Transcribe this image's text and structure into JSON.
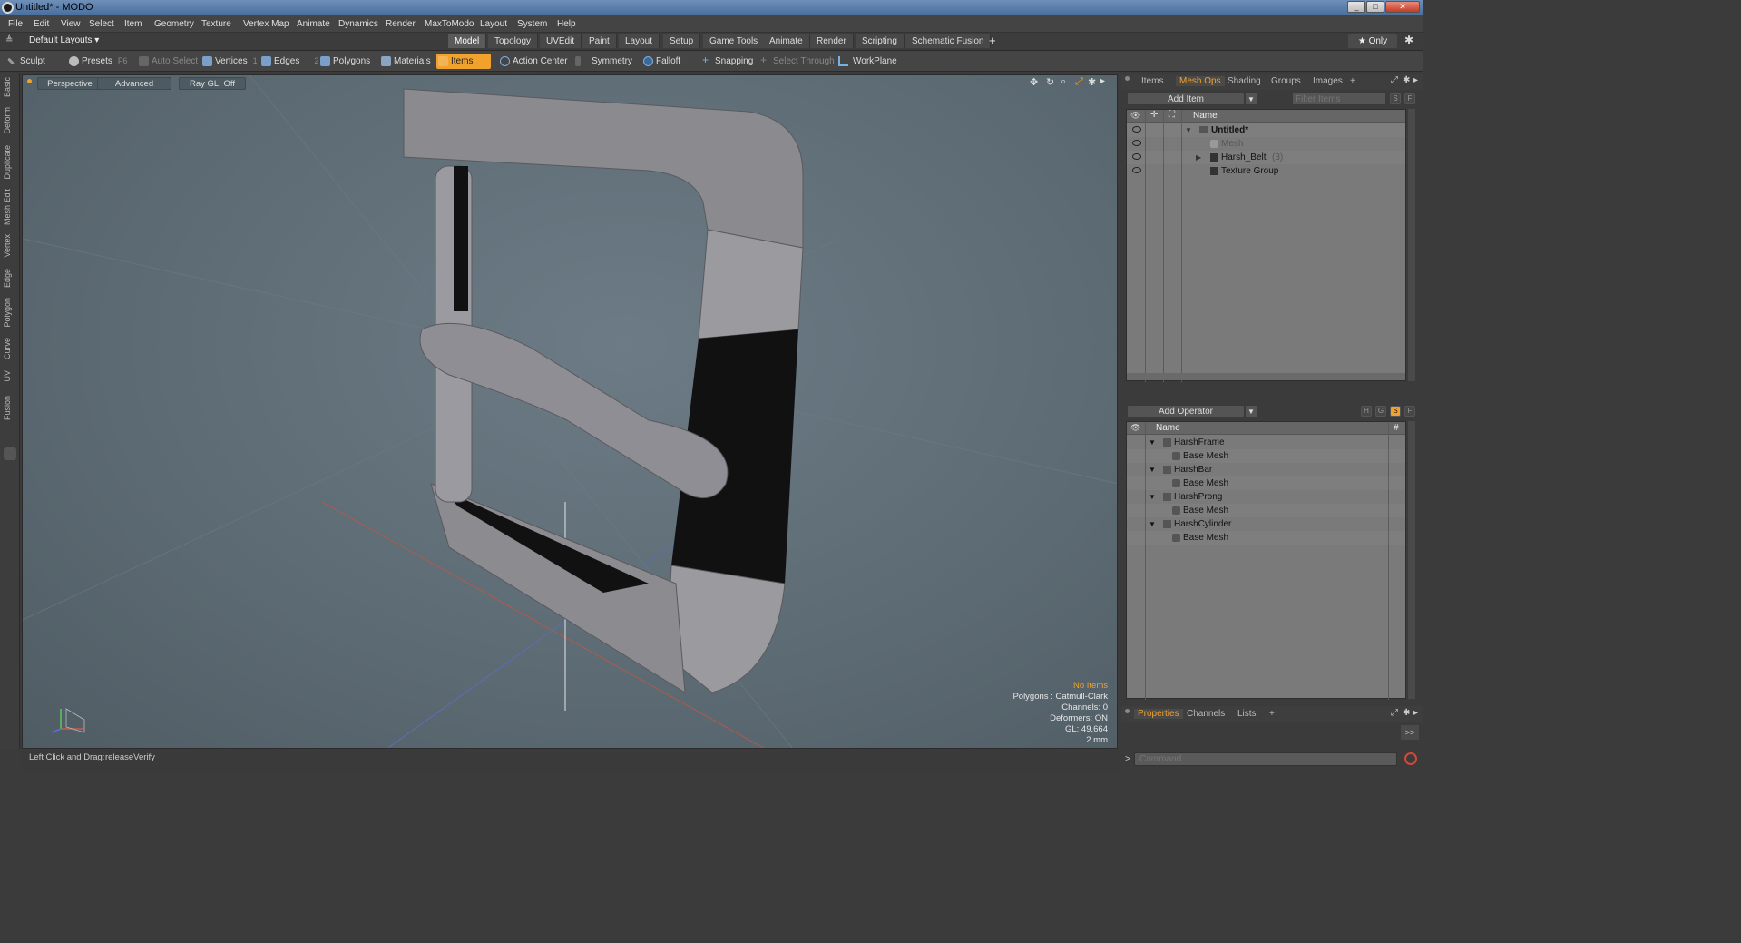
{
  "window": {
    "title": "Untitled* - MODO"
  },
  "menu": [
    "File",
    "Edit",
    "View",
    "Select",
    "Item",
    "Geometry",
    "Texture",
    "Vertex Map",
    "Animate",
    "Dynamics",
    "Render",
    "MaxToModo",
    "Layout",
    "System",
    "Help"
  ],
  "layout_bar": {
    "layout_label": "Default Layouts ▾",
    "tabs": [
      "Model",
      "Topology",
      "UVEdit",
      "Paint",
      "Layout",
      "Setup",
      "Game Tools",
      "Animate",
      "Render",
      "Scripting",
      "Schematic Fusion"
    ],
    "active_tab": "Model",
    "plus": "+",
    "only_label": "★ Only"
  },
  "toolbar": {
    "sculpt": "Sculpt",
    "presets": "Presets",
    "presets_key": "F6",
    "auto_select": "Auto Select",
    "vertices": "Vertices",
    "vertices_key": "1",
    "edges": "Edges",
    "edges_key": "2",
    "polygons": "Polygons",
    "materials": "Materials",
    "items": "Items",
    "action_center": "Action Center",
    "symmetry": "Symmetry",
    "falloff": "Falloff",
    "snapping": "Snapping",
    "select_through": "Select Through",
    "workplane": "WorkPlane"
  },
  "left_tabs": [
    "Basic",
    "Deform",
    "Duplicate",
    "Mesh Edit",
    "Vertex",
    "Edge",
    "Polygon",
    "Curve",
    "UV",
    "Fusion"
  ],
  "viewport": {
    "view_mode": "Perspective",
    "advanced": "Advanced",
    "raygl": "Ray GL: Off",
    "hud": {
      "no_items": "No Items",
      "polygons": "Polygons : Catmull-Clark",
      "channels": "Channels: 0",
      "deformers": "Deformers: ON",
      "gl": "GL: 49,664",
      "scale": "2 mm"
    }
  },
  "status": {
    "hint": "Left Click and Drag:",
    "action": "releaseVerify"
  },
  "items_panel": {
    "tabs": [
      "Items",
      "Mesh Ops",
      "Shading",
      "Groups",
      "Images"
    ],
    "active_tab": "Mesh Ops",
    "add_item": "Add Item",
    "filter_placeholder": "Filter Items",
    "s_label": "S",
    "f_label": "F",
    "col_name": "Name",
    "rows": [
      {
        "name": "Untitled*",
        "level": 0,
        "expand": "▼"
      },
      {
        "name": "Mesh",
        "level": 1,
        "expand": ""
      },
      {
        "name": "Harsh_Belt",
        "count": "(3)",
        "level": 1,
        "expand": "▶"
      },
      {
        "name": "Texture Group",
        "level": 1,
        "expand": ""
      }
    ]
  },
  "meshops_panel": {
    "add_operator": "Add Operator",
    "h_label": "H",
    "g_label": "G",
    "s_label": "S",
    "f_label": "F",
    "col_name": "Name",
    "col_hash": "#",
    "rows": [
      {
        "name": "HarshFrame",
        "level": 0
      },
      {
        "name": "Base Mesh",
        "level": 1
      },
      {
        "name": "HarshBar",
        "level": 0
      },
      {
        "name": "Base Mesh",
        "level": 1
      },
      {
        "name": "HarshProng",
        "level": 0
      },
      {
        "name": "Base Mesh",
        "level": 1
      },
      {
        "name": "HarshCylinder",
        "level": 0
      },
      {
        "name": "Base Mesh",
        "level": 1
      }
    ]
  },
  "properties_panel": {
    "tabs": [
      "Properties",
      "Channels",
      "Lists"
    ],
    "active_tab": "Properties",
    "plus": "+",
    "expand": ">>",
    "command_placeholder": "Command"
  },
  "colors": {
    "accent": "#f0a22c",
    "viewport_bg": "#5f6d76"
  }
}
